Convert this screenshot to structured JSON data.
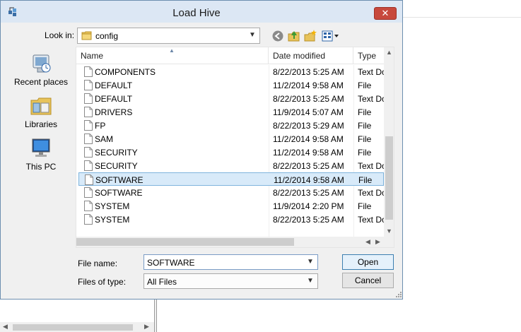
{
  "window": {
    "title": "Load Hive",
    "close_glyph": "✕",
    "app_icon": "registry-editor-icon"
  },
  "toolbar": {
    "look_in_label": "Look in:",
    "look_in_value": "config",
    "back_icon": "back-arrow-icon",
    "up_icon": "up-folder-icon",
    "new_folder_icon": "new-folder-icon",
    "views_icon": "view-menu-icon"
  },
  "places": [
    {
      "label": "Recent places",
      "icon": "recent-places-icon"
    },
    {
      "label": "Libraries",
      "icon": "libraries-icon"
    },
    {
      "label": "This PC",
      "icon": "this-pc-icon"
    }
  ],
  "columns": {
    "name": "Name",
    "date": "Date modified",
    "type": "Type"
  },
  "files": [
    {
      "name": "COMPONENTS",
      "date": "8/22/2013 5:25 AM",
      "type": "Text Do",
      "selected": false
    },
    {
      "name": "DEFAULT",
      "date": "11/2/2014 9:58 AM",
      "type": "File",
      "selected": false
    },
    {
      "name": "DEFAULT",
      "date": "8/22/2013 5:25 AM",
      "type": "Text Do",
      "selected": false
    },
    {
      "name": "DRIVERS",
      "date": "11/9/2014 5:07 AM",
      "type": "File",
      "selected": false
    },
    {
      "name": "FP",
      "date": "8/22/2013 5:29 AM",
      "type": "File",
      "selected": false
    },
    {
      "name": "SAM",
      "date": "11/2/2014 9:58 AM",
      "type": "File",
      "selected": false
    },
    {
      "name": "SECURITY",
      "date": "11/2/2014 9:58 AM",
      "type": "File",
      "selected": false
    },
    {
      "name": "SECURITY",
      "date": "8/22/2013 5:25 AM",
      "type": "Text Do",
      "selected": false
    },
    {
      "name": "SOFTWARE",
      "date": "11/2/2014 9:58 AM",
      "type": "File",
      "selected": true
    },
    {
      "name": "SOFTWARE",
      "date": "8/22/2013 5:25 AM",
      "type": "Text Do",
      "selected": false
    },
    {
      "name": "SYSTEM",
      "date": "11/9/2014 2:20 PM",
      "type": "File",
      "selected": false
    },
    {
      "name": "SYSTEM",
      "date": "8/22/2013 5:25 AM",
      "type": "Text Do",
      "selected": false
    }
  ],
  "form": {
    "file_name_label": "File name:",
    "file_name_value": "SOFTWARE",
    "file_type_label": "Files of type:",
    "file_type_value": "All Files",
    "open_label": "Open",
    "cancel_label": "Cancel"
  },
  "colors": {
    "titlebar": "#dce7f4",
    "close": "#c7493d",
    "selection": "#d8eaf9",
    "selection_border": "#7fb4dd"
  }
}
